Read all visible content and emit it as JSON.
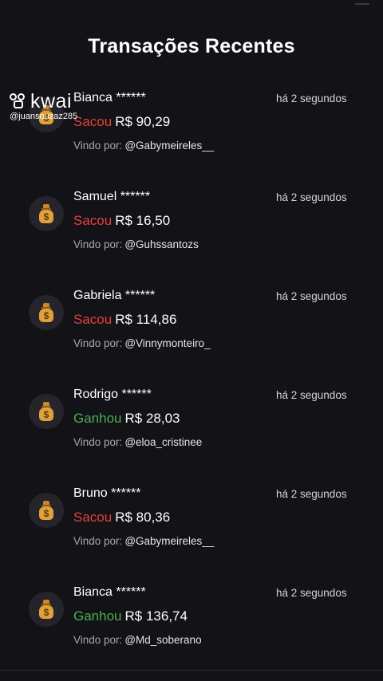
{
  "page": {
    "title": "Transações Recentes"
  },
  "watermark": {
    "brand": "kwai",
    "handle": "@juansouzaz285"
  },
  "transactions": [
    {
      "name": "Bianca ******",
      "time": "há 2 segundos",
      "action": "Sacou",
      "action_type": "sacou",
      "amount": "R$ 90,29",
      "via_label": "Vindo por:",
      "via_user": "@Gabymeireles__",
      "icon": "money-bag-icon"
    },
    {
      "name": "Samuel ******",
      "time": "há 2 segundos",
      "action": "Sacou",
      "action_type": "sacou",
      "amount": "R$ 16,50",
      "via_label": "Vindo por:",
      "via_user": "@Guhssantozs",
      "icon": "money-bag-icon"
    },
    {
      "name": "Gabriela ******",
      "time": "há 2 segundos",
      "action": "Sacou",
      "action_type": "sacou",
      "amount": "R$ 114,86",
      "via_label": "Vindo por:",
      "via_user": "@Vinnymonteiro_",
      "icon": "money-bag-icon"
    },
    {
      "name": "Rodrigo ******",
      "time": "há 2 segundos",
      "action": "Ganhou",
      "action_type": "ganhou",
      "amount": "R$ 28,03",
      "via_label": "Vindo por:",
      "via_user": "@eloa_cristinee",
      "icon": "money-bag-icon"
    },
    {
      "name": "Bruno ******",
      "time": "há 2 segundos",
      "action": "Sacou",
      "action_type": "sacou",
      "amount": "R$ 80,36",
      "via_label": "Vindo por:",
      "via_user": "@Gabymeireles__",
      "icon": "money-bag-icon"
    },
    {
      "name": "Bianca ******",
      "time": "há 2 segundos",
      "action": "Ganhou",
      "action_type": "ganhou",
      "amount": "R$ 136,74",
      "via_label": "Vindo por:",
      "via_user": "@Md_soberano",
      "icon": "money-bag-icon"
    }
  ],
  "colors": {
    "background": "#121217",
    "sacou": "#e5403c",
    "ganhou": "#4caf50",
    "icon_bg": "#24242a"
  }
}
